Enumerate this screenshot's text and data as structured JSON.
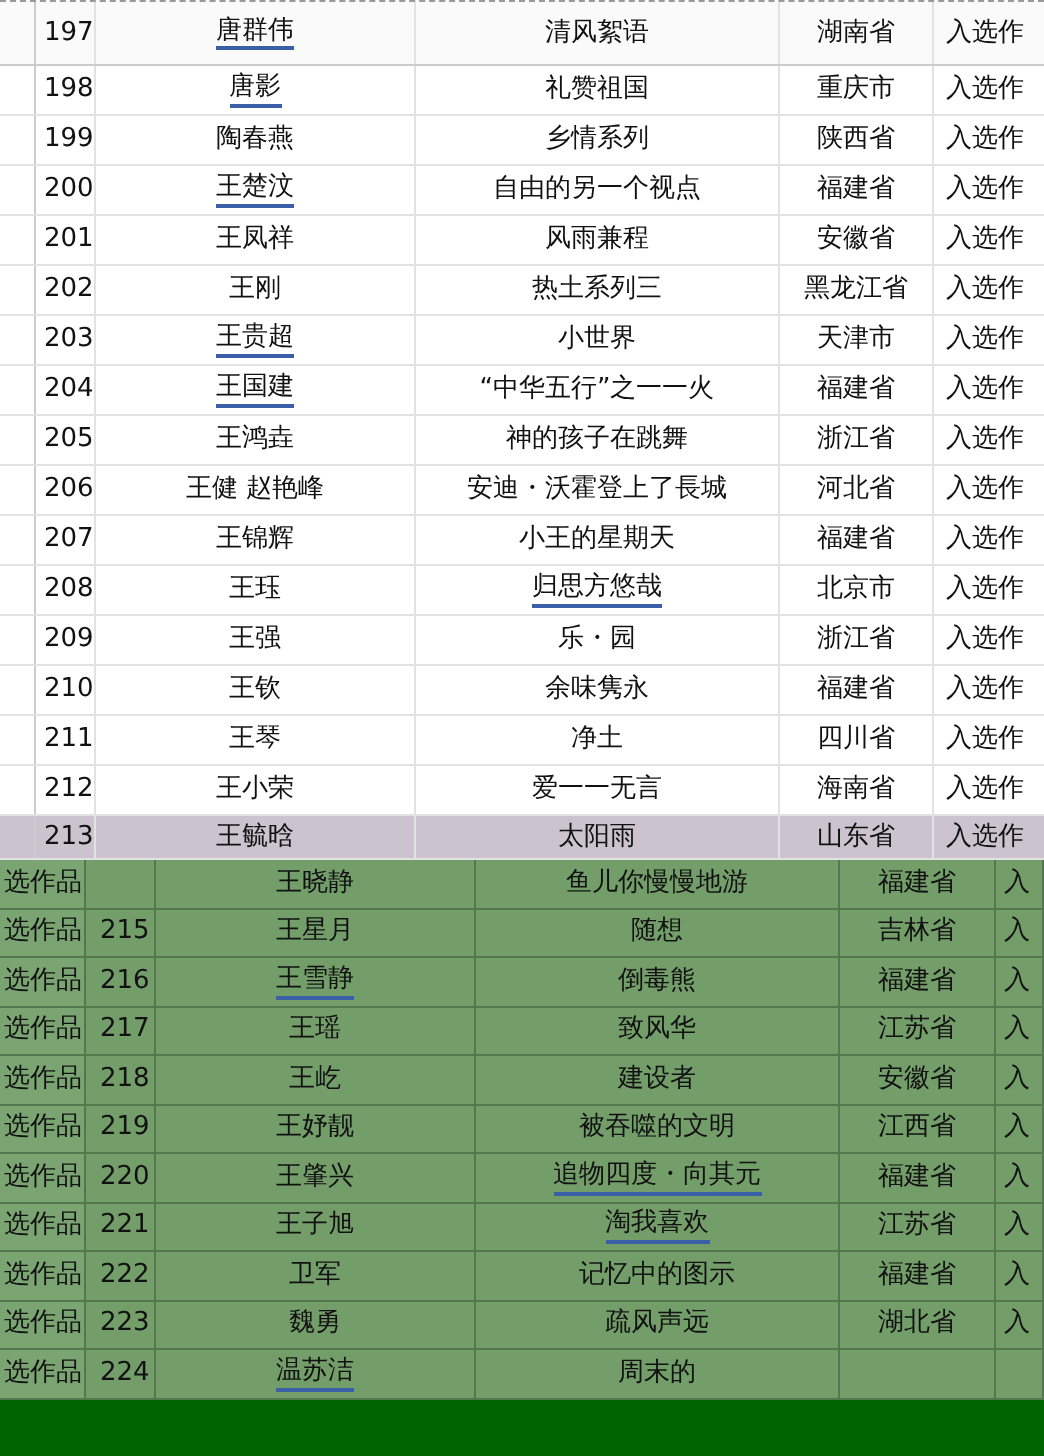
{
  "top_table": {
    "rows": [
      {
        "no": "197",
        "name": "唐群伟",
        "work": "清风絮语",
        "province": "湖南省",
        "status": "入选作",
        "name_flagged": true,
        "work_flagged": false
      },
      {
        "no": "198",
        "name": "唐影",
        "work": "礼赞祖国",
        "province": "重庆市",
        "status": "入选作",
        "name_flagged": true,
        "work_flagged": false
      },
      {
        "no": "199",
        "name": "陶春燕",
        "work": "乡情系列",
        "province": "陕西省",
        "status": "入选作",
        "name_flagged": false,
        "work_flagged": false
      },
      {
        "no": "200",
        "name": "王楚汶",
        "work": "自由的另一个视点",
        "province": "福建省",
        "status": "入选作",
        "name_flagged": true,
        "work_flagged": false
      },
      {
        "no": "201",
        "name": "王凤祥",
        "work": "风雨兼程",
        "province": "安徽省",
        "status": "入选作",
        "name_flagged": false,
        "work_flagged": false
      },
      {
        "no": "202",
        "name": "王刚",
        "work": "热土系列三",
        "province": "黑龙江省",
        "status": "入选作",
        "name_flagged": false,
        "work_flagged": false
      },
      {
        "no": "203",
        "name": "王贵超",
        "work": "小世界",
        "province": "天津市",
        "status": "入选作",
        "name_flagged": true,
        "work_flagged": false
      },
      {
        "no": "204",
        "name": "王国建",
        "work": "“中华五行”之一一火",
        "province": "福建省",
        "status": "入选作",
        "name_flagged": true,
        "work_flagged": false
      },
      {
        "no": "205",
        "name": "王鸿垚",
        "work": "神的孩子在跳舞",
        "province": "浙江省",
        "status": "入选作",
        "name_flagged": false,
        "work_flagged": false
      },
      {
        "no": "206",
        "name": "王健 赵艳峰",
        "work": "安迪・沃霍登上了長城",
        "province": "河北省",
        "status": "入选作",
        "name_flagged": false,
        "work_flagged": false
      },
      {
        "no": "207",
        "name": "王锦辉",
        "work": "小王的星期天",
        "province": "福建省",
        "status": "入选作",
        "name_flagged": false,
        "work_flagged": false
      },
      {
        "no": "208",
        "name": "王珏",
        "work": "归思方悠哉",
        "province": "北京市",
        "status": "入选作",
        "name_flagged": false,
        "work_flagged": true
      },
      {
        "no": "209",
        "name": "王强",
        "work": "乐・园",
        "province": "浙江省",
        "status": "入选作",
        "name_flagged": false,
        "work_flagged": false
      },
      {
        "no": "210",
        "name": "王钦",
        "work": "余味隽永",
        "province": "福建省",
        "status": "入选作",
        "name_flagged": false,
        "work_flagged": false
      },
      {
        "no": "211",
        "name": "王琴",
        "work": "净土",
        "province": "四川省",
        "status": "入选作",
        "name_flagged": false,
        "work_flagged": false
      },
      {
        "no": "212",
        "name": "王小荣",
        "work": "爱一一无言",
        "province": "海南省",
        "status": "入选作",
        "name_flagged": false,
        "work_flagged": false
      },
      {
        "no": "213",
        "name": "王毓晗",
        "work": "太阳雨",
        "province": "山东省",
        "status": "入选作",
        "name_flagged": false,
        "work_flagged": false
      }
    ]
  },
  "green_table": {
    "rows": [
      {
        "side": "选作品",
        "name": "王晓静",
        "work": "鱼儿你慢慢地游",
        "province": "福建省",
        "status": "入",
        "name_flagged": false,
        "work_flagged": false
      },
      {
        "side": "选作品",
        "no": "215",
        "name": "王星月",
        "work": "随想",
        "province": "吉林省",
        "status": "入",
        "name_flagged": false,
        "work_flagged": false
      },
      {
        "side": "选作品",
        "no": "216",
        "name": "王雪静",
        "work": "倒毒熊",
        "province": "福建省",
        "status": "入",
        "name_flagged": true,
        "work_flagged": false
      },
      {
        "side": "选作品",
        "no": "217",
        "name": "王瑶",
        "work": "致风华",
        "province": "江苏省",
        "status": "入",
        "name_flagged": false,
        "work_flagged": false
      },
      {
        "side": "选作品",
        "no": "218",
        "name": "王屹",
        "work": "建设者",
        "province": "安徽省",
        "status": "入",
        "name_flagged": false,
        "work_flagged": false
      },
      {
        "side": "选作品",
        "no": "219",
        "name": "王妤靓",
        "work": "被吞噬的文明",
        "province": "江西省",
        "status": "入",
        "name_flagged": false,
        "work_flagged": false
      },
      {
        "side": "选作品",
        "no": "220",
        "name": "王肇兴",
        "work": "追物四度・向其元",
        "province": "福建省",
        "status": "入",
        "name_flagged": false,
        "work_flagged": true
      },
      {
        "side": "选作品",
        "no": "221",
        "name": "王子旭",
        "work": "淘我喜欢",
        "province": "江苏省",
        "status": "入",
        "name_flagged": false,
        "work_flagged": true
      },
      {
        "side": "选作品",
        "no": "222",
        "name": "卫军",
        "work": "记忆中的图示",
        "province": "福建省",
        "status": "入",
        "name_flagged": false,
        "work_flagged": false
      },
      {
        "side": "选作品",
        "no": "223",
        "name": "魏勇",
        "work": "疏风声远",
        "province": "湖北省",
        "status": "入",
        "name_flagged": false,
        "work_flagged": false
      },
      {
        "side": "选作品",
        "no": "224",
        "name": "温苏洁",
        "work": "周末的",
        "name_flagged": true,
        "work_flagged": false
      }
    ]
  }
}
